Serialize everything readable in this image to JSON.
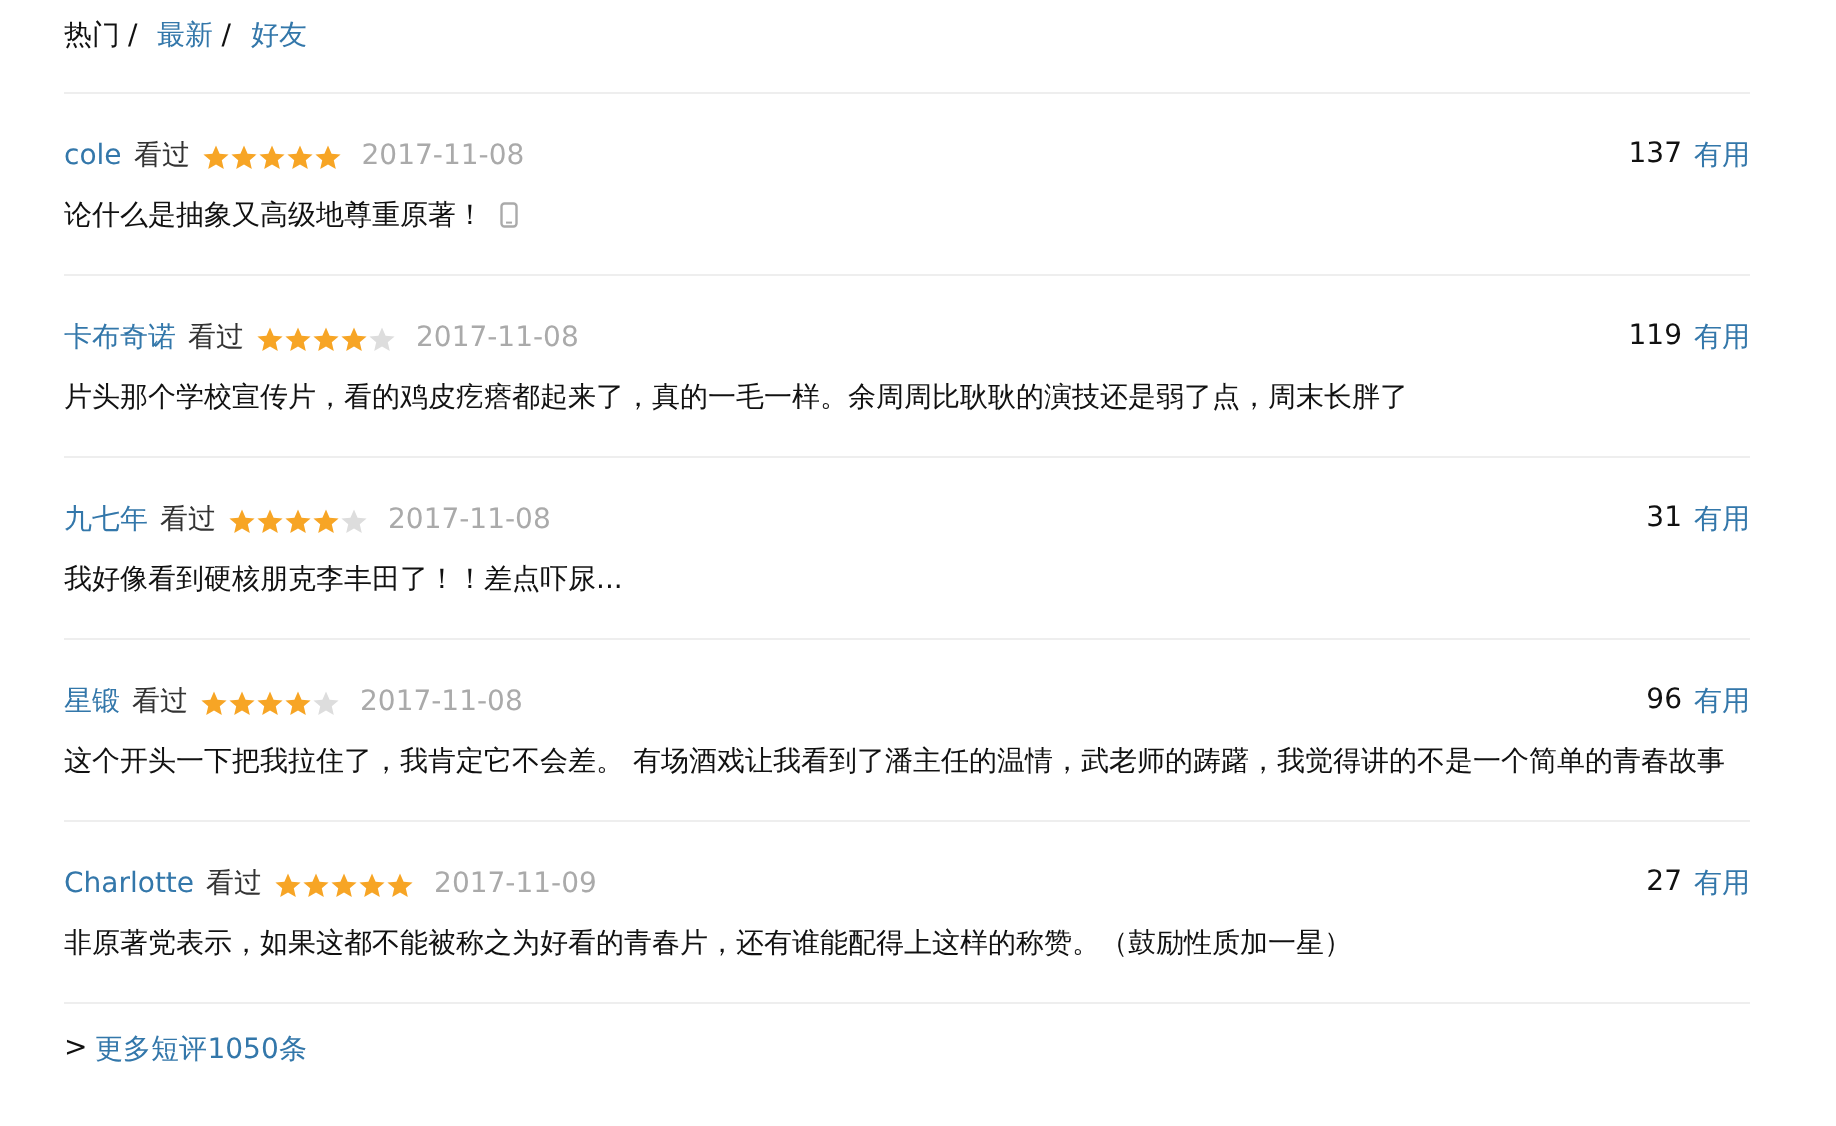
{
  "tabs": [
    {
      "label": "热门",
      "selected": true,
      "separator": "/"
    },
    {
      "label": "最新",
      "selected": false,
      "separator": "/"
    },
    {
      "label": "好友",
      "selected": false
    }
  ],
  "reviews": [
    {
      "user": "cole",
      "status": "看过",
      "stars": 5,
      "date": "2017-11-08",
      "votes": "137",
      "vote_label": "有用",
      "text": "论什么是抽象又高级地尊重原著！",
      "mobile": true
    },
    {
      "user": "卡布奇诺",
      "status": "看过",
      "stars": 4,
      "date": "2017-11-08",
      "votes": "119",
      "vote_label": "有用",
      "text": "片头那个学校宣传片，看的鸡皮疙瘩都起来了，真的一毛一样。余周周比耿耿的演技还是弱了点，周末长胖了",
      "mobile": false
    },
    {
      "user": "九七年",
      "status": "看过",
      "stars": 4,
      "date": "2017-11-08",
      "votes": "31",
      "vote_label": "有用",
      "text": "我好像看到硬核朋克李丰田了！！差点吓尿...",
      "mobile": false
    },
    {
      "user": "星锻",
      "status": "看过",
      "stars": 4,
      "date": "2017-11-08",
      "votes": "96",
      "vote_label": "有用",
      "text": "这个开头一下把我拉住了，我肯定它不会差。 有场酒戏让我看到了潘主任的温情，武老师的踌躇，我觉得讲的不是一个简单的青春故事",
      "mobile": false
    },
    {
      "user": "Charlotte",
      "status": "看过",
      "stars": 5,
      "date": "2017-11-09",
      "votes": "27",
      "vote_label": "有用",
      "text": "非原著党表示，如果这都不能被称之为好看的青春片，还有谁能配得上这样的称赞。（鼓励性质加一星）",
      "mobile": false
    }
  ],
  "more": {
    "arrow": ">",
    "label": "更多短评1050条"
  }
}
